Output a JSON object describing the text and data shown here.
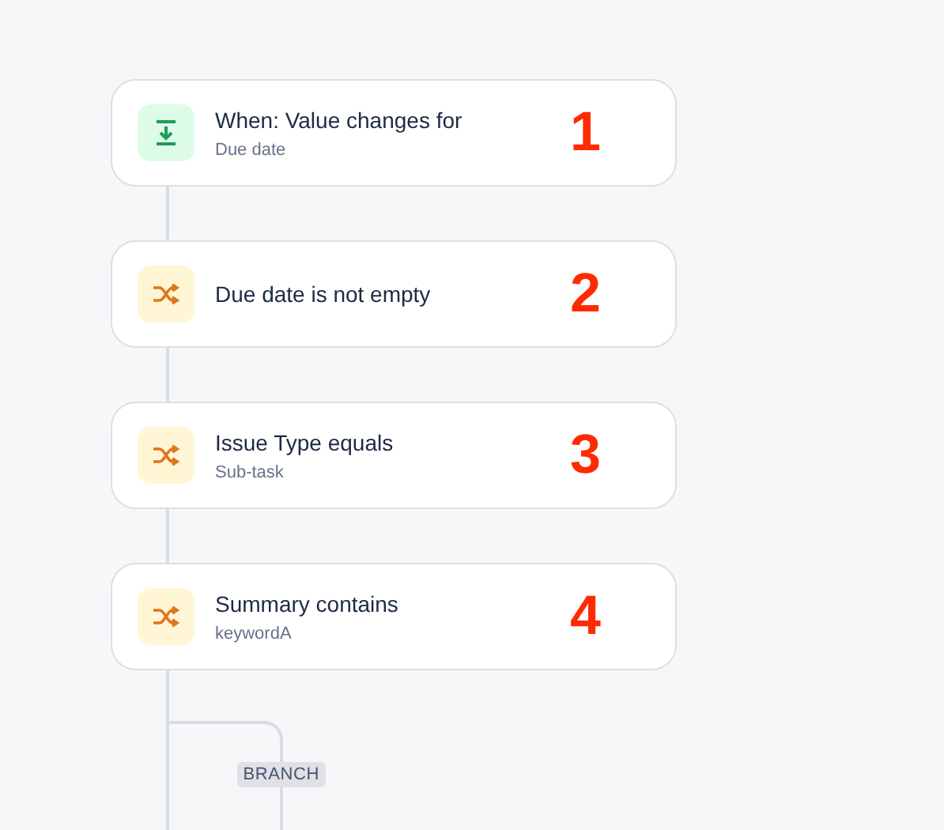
{
  "steps": [
    {
      "kind": "trigger",
      "title": "When: Value changes for",
      "subtitle": "Due date",
      "number": "1"
    },
    {
      "kind": "condition",
      "title": "Due date is not empty",
      "number": "2"
    },
    {
      "kind": "condition",
      "title": "Issue Type equals",
      "subtitle": "Sub-task",
      "number": "3"
    },
    {
      "kind": "condition",
      "title": "Summary contains",
      "subtitle": "keywordA",
      "number": "4"
    }
  ],
  "branch": {
    "label": "BRANCH"
  }
}
